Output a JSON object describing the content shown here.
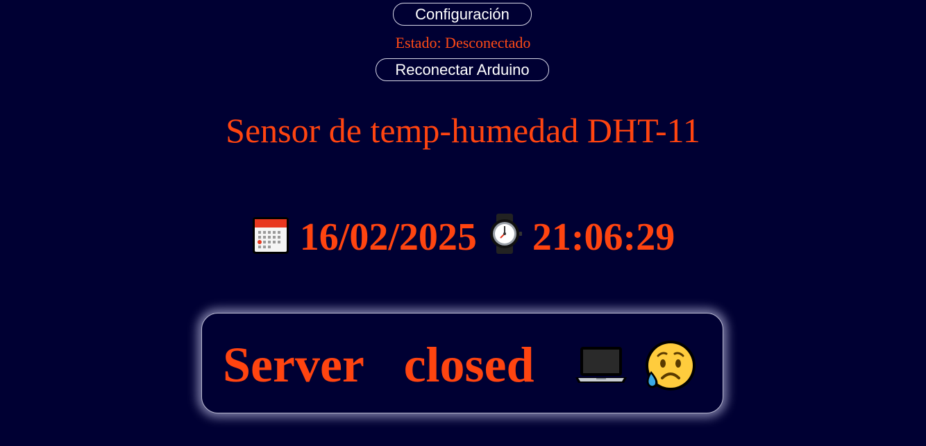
{
  "header": {
    "config_button": "Configuración",
    "status_text": "Estado: Desconectado",
    "reconnect_button": "Reconectar Arduino"
  },
  "main": {
    "title": "Sensor de temp-humedad DHT-11",
    "date": "16/02/2025",
    "time": "21:06:29",
    "server_message": "Server closed"
  },
  "icons": {
    "date": "calendar-icon",
    "time": "watch-icon",
    "server": [
      "laptop-icon",
      "sad-face-icon"
    ]
  },
  "colors": {
    "background": "#000033",
    "accent": "#ff4410",
    "button_text": "#ffffff"
  }
}
